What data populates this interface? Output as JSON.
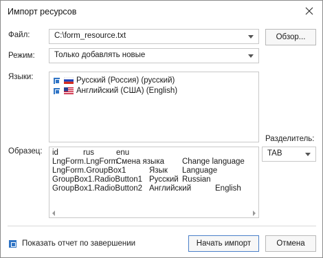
{
  "window": {
    "title": "Импорт ресурсов"
  },
  "form": {
    "file_label": "Файл:",
    "file_value": "C:\\form_resource.txt",
    "browse_label": "Обзор...",
    "mode_label": "Режим:",
    "mode_value": "Только добавлять новые",
    "languages_label": "Языки:",
    "languages": [
      {
        "label": "Русский (Россия) (русский)",
        "checked": true
      },
      {
        "label": "Английский (США) (English)",
        "checked": true
      }
    ],
    "separator_label": "Разделитель:",
    "separator_value": "TAB",
    "sample_label": "Образец:",
    "sample_rows": [
      [
        "id",
        "rus",
        "enu"
      ],
      [
        "LngForm.LngForm",
        "Смена языка",
        "Change language"
      ],
      [
        "LngForm.GroupBox1",
        "Язык",
        "Language"
      ],
      [
        "GroupBox1.RadioButton1",
        "Русский",
        "Russian"
      ],
      [
        "GroupBox1.RadioButton2",
        "Английский",
        "English"
      ]
    ]
  },
  "footer": {
    "show_report_label": "Показать отчет по завершении",
    "show_report_checked": true,
    "start_label": "Начать импорт",
    "cancel_label": "Отмена"
  },
  "colors": {
    "accent": "#2f74c5",
    "border": "#c8c8c8",
    "primary_border": "#4a7fc8"
  }
}
